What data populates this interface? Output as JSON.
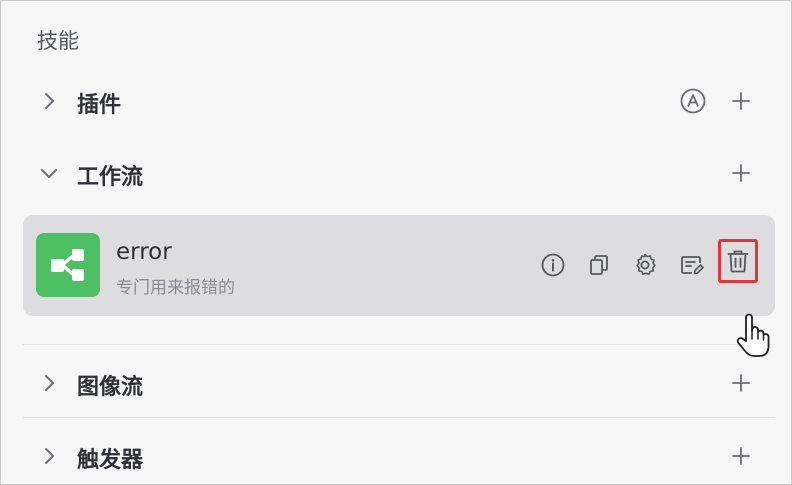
{
  "section": {
    "title": "技能"
  },
  "groups": [
    {
      "label": "插件",
      "expanded": false,
      "icons": [
        "auto-a-icon",
        "plus-icon"
      ]
    },
    {
      "label": "工作流",
      "expanded": true,
      "icons": [
        "plus-icon"
      ]
    },
    {
      "label": "图像流",
      "expanded": false,
      "icons": [
        "plus-icon"
      ]
    },
    {
      "label": "触发器",
      "expanded": false,
      "icons": [
        "plus-icon"
      ]
    }
  ],
  "workflow_item": {
    "name": "error",
    "description": "专门用来报错的",
    "icon": "workflow-icon",
    "actions": [
      "info-icon",
      "copy-icon",
      "settings-icon",
      "edit-icon",
      "delete-icon"
    ],
    "highlighted_action": "delete-icon",
    "highlight_color": "#e0353c"
  },
  "colors": {
    "workflow_icon_bg": "#4fbf63",
    "card_bg": "#dddddf",
    "panel_bg": "#f7f7f8"
  }
}
